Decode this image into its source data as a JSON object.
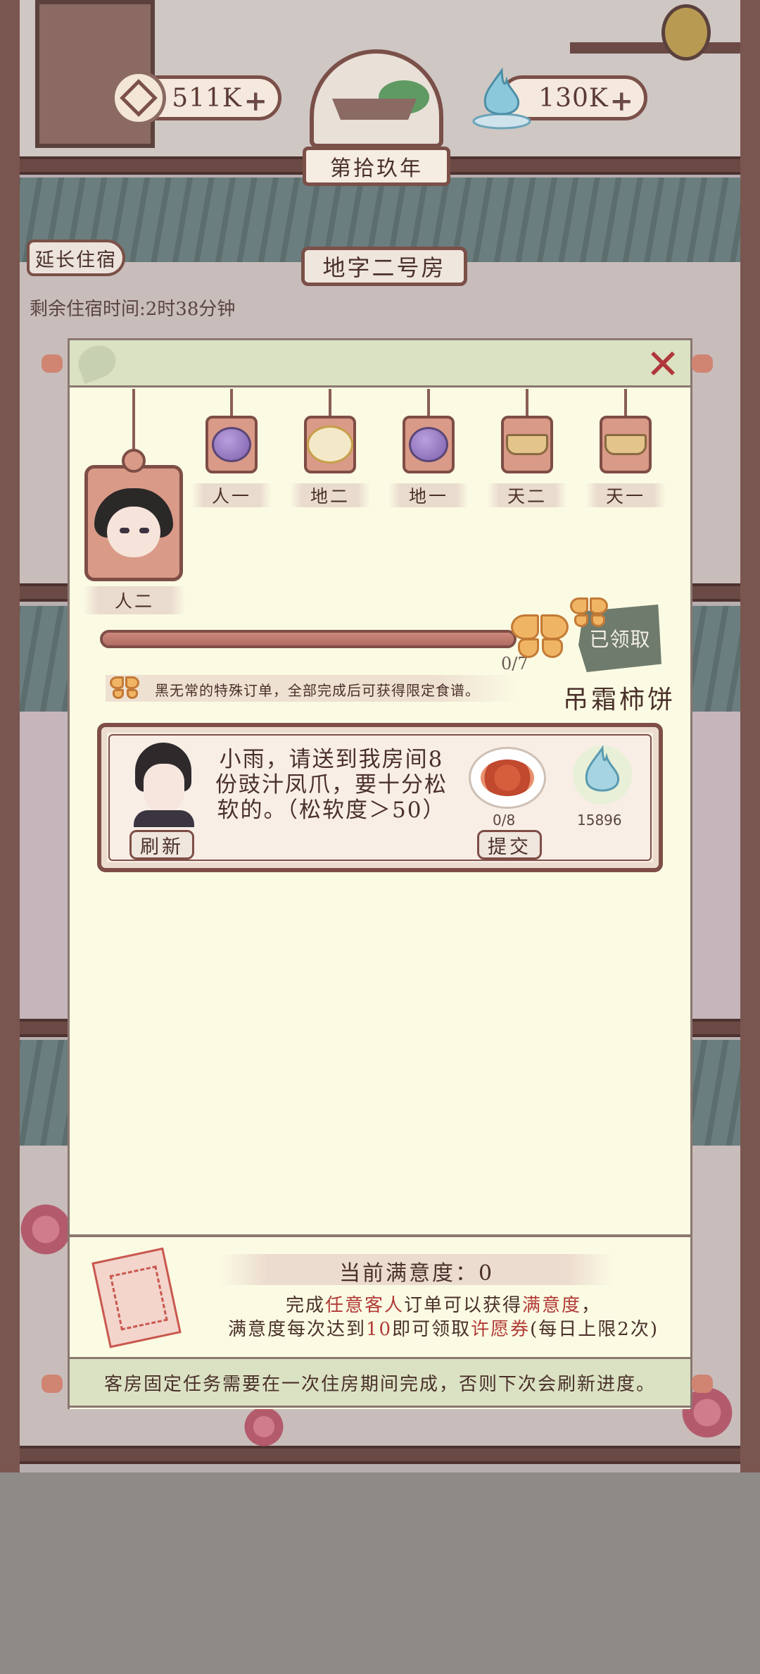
{
  "hud": {
    "coins": "511K",
    "spirit": "130K",
    "plus_symbol": "+",
    "year": "第拾玖年"
  },
  "room": {
    "extend_button": "延长住宿",
    "title": "地字二号房",
    "stay_time": "剩余住宿时间:2时38分钟"
  },
  "panel": {
    "close_symbol": "✕",
    "current_tag": "人二",
    "tags": [
      {
        "label": "人一",
        "icon": "purple-fruit-icon"
      },
      {
        "label": "地二",
        "icon": "ram-icon"
      },
      {
        "label": "地一",
        "icon": "purple-fruit-icon"
      },
      {
        "label": "天二",
        "icon": "ingot-icon"
      },
      {
        "label": "天一",
        "icon": "ingot-icon"
      }
    ],
    "progress": {
      "count": "0/7",
      "value": 0,
      "total": 7
    },
    "reward_status": "已领取",
    "recipe_name": "吊霜柿饼",
    "hint": "黑无常的特殊订单，全部完成后可获得限定食谱。"
  },
  "order": {
    "text": "小雨，请送到我房间8份豉汁凤爪，要十分松软的。（松软度＞50）",
    "refresh_label": "刷新",
    "submit_label": "提交",
    "dish_count": "0/8",
    "reward_amount": "15896"
  },
  "satisfaction": {
    "current": "当前满意度：0",
    "rule_line1_a": "完成",
    "rule_line1_b": "任意客人",
    "rule_line1_c": "订单可以获得",
    "rule_line1_d": "满意度",
    "rule_line1_e": "，",
    "rule_line2_a": "满意度每次达到",
    "rule_line2_b": "10",
    "rule_line2_c": "即可领取",
    "rule_line2_d": "许愿券",
    "rule_line2_e": "(每日上限2次)"
  },
  "footer_notice": "客房固定任务需要在一次住房期间完成，否则下次会刷新进度。",
  "colors": {
    "accent_red": "#b23a36",
    "frame_brown": "#7e4e46",
    "panel_bg": "#fbfbe3",
    "header_green": "#dbe2c3"
  }
}
